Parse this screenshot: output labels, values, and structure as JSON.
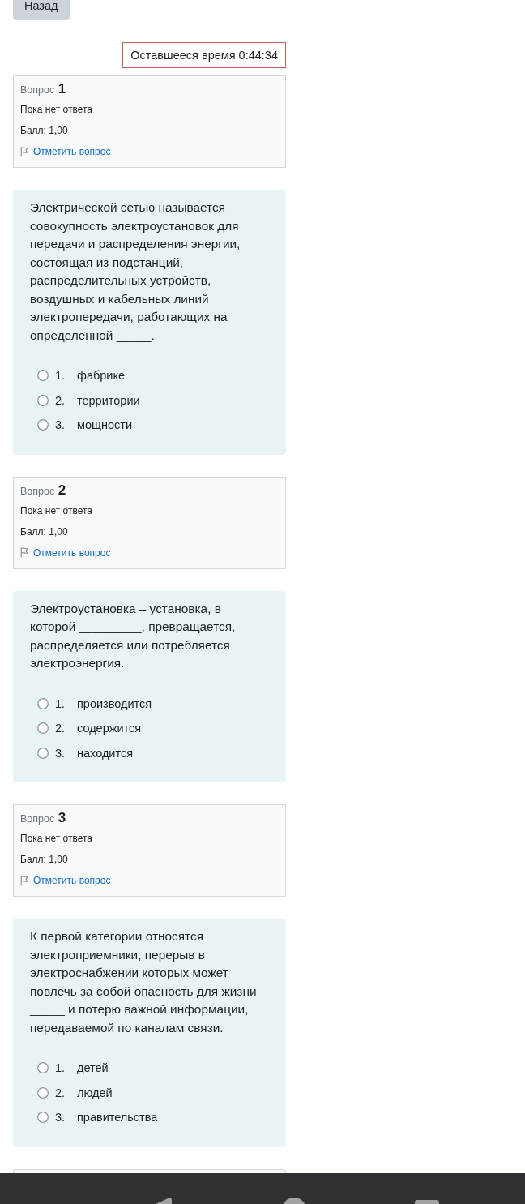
{
  "back_button": {
    "label": "Назад"
  },
  "timer": {
    "text": "Оставшееся время 0:44:34"
  },
  "questions": [
    {
      "label": "Вопрос",
      "number": "1",
      "status": "Пока нет ответа",
      "grade": "Балл: 1,00",
      "flag_link": "Отметить вопрос",
      "text": "Электрической сетью называется совокупность электроустановок для передачи и распределения энергии, состоящая из подстанций, распределительных устройств, воздушных и кабельных линий электропередачи, работающих на определенной _____.",
      "options": [
        {
          "number": "1.",
          "text": "фабрике",
          "selected": false
        },
        {
          "number": "2.",
          "text": "территории",
          "selected": false
        },
        {
          "number": "3.",
          "text": "мощности",
          "selected": false
        }
      ]
    },
    {
      "label": "Вопрос",
      "number": "2",
      "status": "Пока нет ответа",
      "grade": "Балл: 1,00",
      "flag_link": "Отметить вопрос",
      "text": "Электроустановка – установка, в которой _________, превращается, распределяется или потребляется электроэнергия.",
      "options": [
        {
          "number": "1.",
          "text": "производится",
          "selected": false
        },
        {
          "number": "2.",
          "text": "содержится",
          "selected": false
        },
        {
          "number": "3.",
          "text": "находится",
          "selected": false
        }
      ]
    },
    {
      "label": "Вопрос",
      "number": "3",
      "status": "Пока нет ответа",
      "grade": "Балл: 1,00",
      "flag_link": "Отметить вопрос",
      "text": "К первой категории относятся электроприемники, перерыв в электроснабжении которых может повлечь за собой опасность для жизни _____ и потерю важной информации, передаваемой по каналам связи.",
      "options": [
        {
          "number": "1.",
          "text": "детей",
          "selected": false
        },
        {
          "number": "2.",
          "text": "людей",
          "selected": false
        },
        {
          "number": "3.",
          "text": "правительства",
          "selected": false
        }
      ]
    }
  ]
}
